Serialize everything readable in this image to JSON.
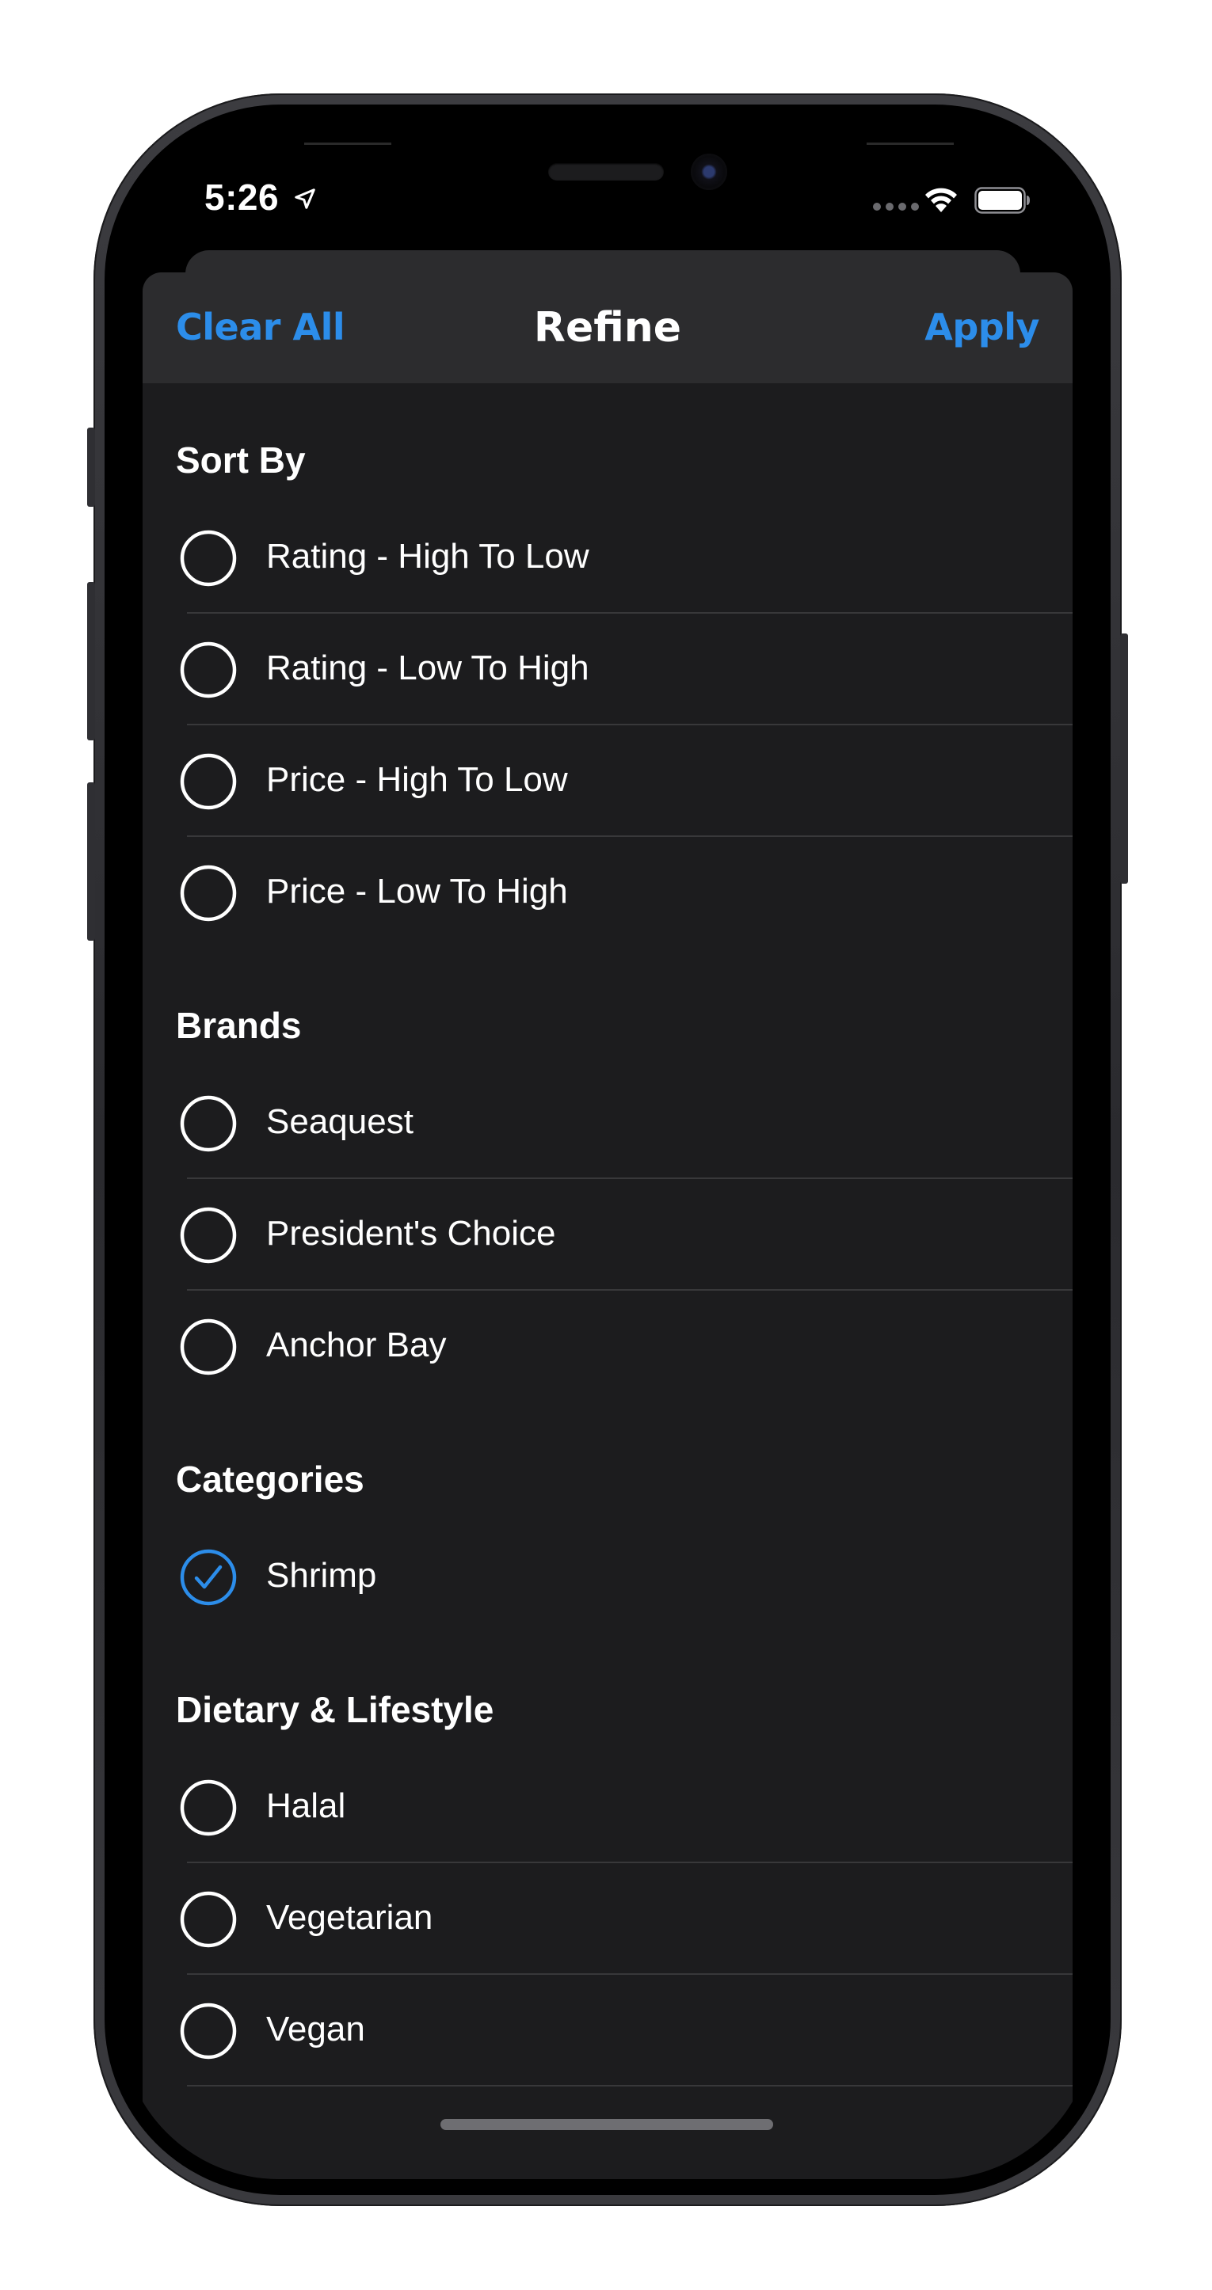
{
  "status_bar": {
    "time": "5:26"
  },
  "nav": {
    "left_label": "Clear All",
    "title": "Refine",
    "right_label": "Apply"
  },
  "colors": {
    "accent": "#2c8dea",
    "background": "#1c1c1e",
    "nav_background": "#2c2c2e"
  },
  "sections": [
    {
      "title": "Sort By",
      "options": [
        {
          "label": "Rating - High To Low",
          "selected": false
        },
        {
          "label": "Rating - Low To High",
          "selected": false
        },
        {
          "label": "Price - High To Low",
          "selected": false
        },
        {
          "label": "Price - Low To High",
          "selected": false
        }
      ]
    },
    {
      "title": "Brands",
      "options": [
        {
          "label": "Seaquest",
          "selected": false
        },
        {
          "label": "President's Choice",
          "selected": false
        },
        {
          "label": "Anchor Bay",
          "selected": false
        }
      ]
    },
    {
      "title": "Categories",
      "options": [
        {
          "label": "Shrimp",
          "selected": true
        }
      ]
    },
    {
      "title": "Dietary & Lifestyle",
      "options": [
        {
          "label": "Halal",
          "selected": false
        },
        {
          "label": "Vegetarian",
          "selected": false
        },
        {
          "label": "Vegan",
          "selected": false
        }
      ]
    }
  ]
}
